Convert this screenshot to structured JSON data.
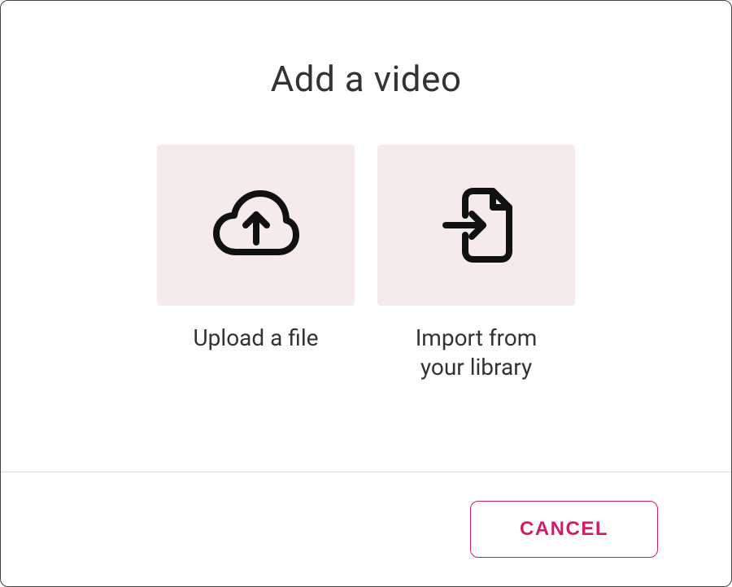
{
  "dialog": {
    "title": "Add a video",
    "options": {
      "upload": {
        "label": "Upload a file"
      },
      "import": {
        "label": "Import from your library"
      }
    },
    "actions": {
      "cancel": "CANCEL"
    }
  }
}
